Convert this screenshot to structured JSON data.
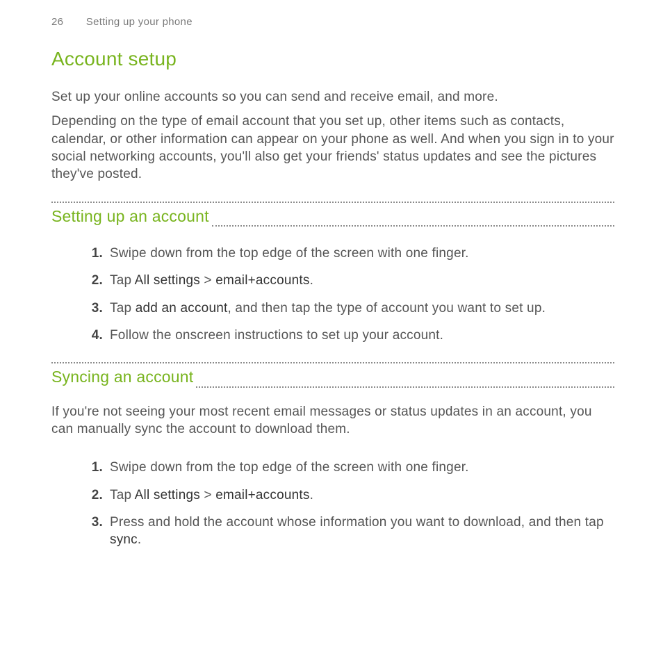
{
  "header": {
    "page_number": "26",
    "running_title": "Setting up your phone"
  },
  "title": "Account setup",
  "intro": {
    "p1": "Set up your online accounts so you can send and receive email, and more.",
    "p2": "Depending on the type of email account that you set up, other items such as contacts, calendar, or other information can appear on your phone as well. And when you sign in to your social networking accounts, you'll also get your friends' status updates and see the pictures they've posted."
  },
  "section1": {
    "heading": "Setting up an account",
    "steps": {
      "s1": {
        "num": "1.",
        "text": "Swipe down from the top edge of the screen with one finger."
      },
      "s2": {
        "num": "2.",
        "pre": "Tap ",
        "b1": "All settings",
        "mid": " > ",
        "b2": "email+accounts",
        "post": "."
      },
      "s3": {
        "num": "3.",
        "pre": "Tap ",
        "b1": "add an account",
        "post": ", and then tap the type of account you want to set up."
      },
      "s4": {
        "num": "4.",
        "text": "Follow the onscreen instructions to set up your account."
      }
    }
  },
  "section2": {
    "heading": "Syncing an account",
    "intro": "If you're not seeing your most recent email messages or status updates in an account, you can manually sync the account to download them.",
    "steps": {
      "s1": {
        "num": "1.",
        "text": "Swipe down from the top edge of the screen with one finger."
      },
      "s2": {
        "num": "2.",
        "pre": "Tap ",
        "b1": "All settings",
        "mid": " > ",
        "b2": "email+accounts",
        "post": "."
      },
      "s3": {
        "num": "3.",
        "pre": "Press and hold the account whose information you want to download, and then tap ",
        "b1": "sync",
        "post": "."
      }
    }
  }
}
